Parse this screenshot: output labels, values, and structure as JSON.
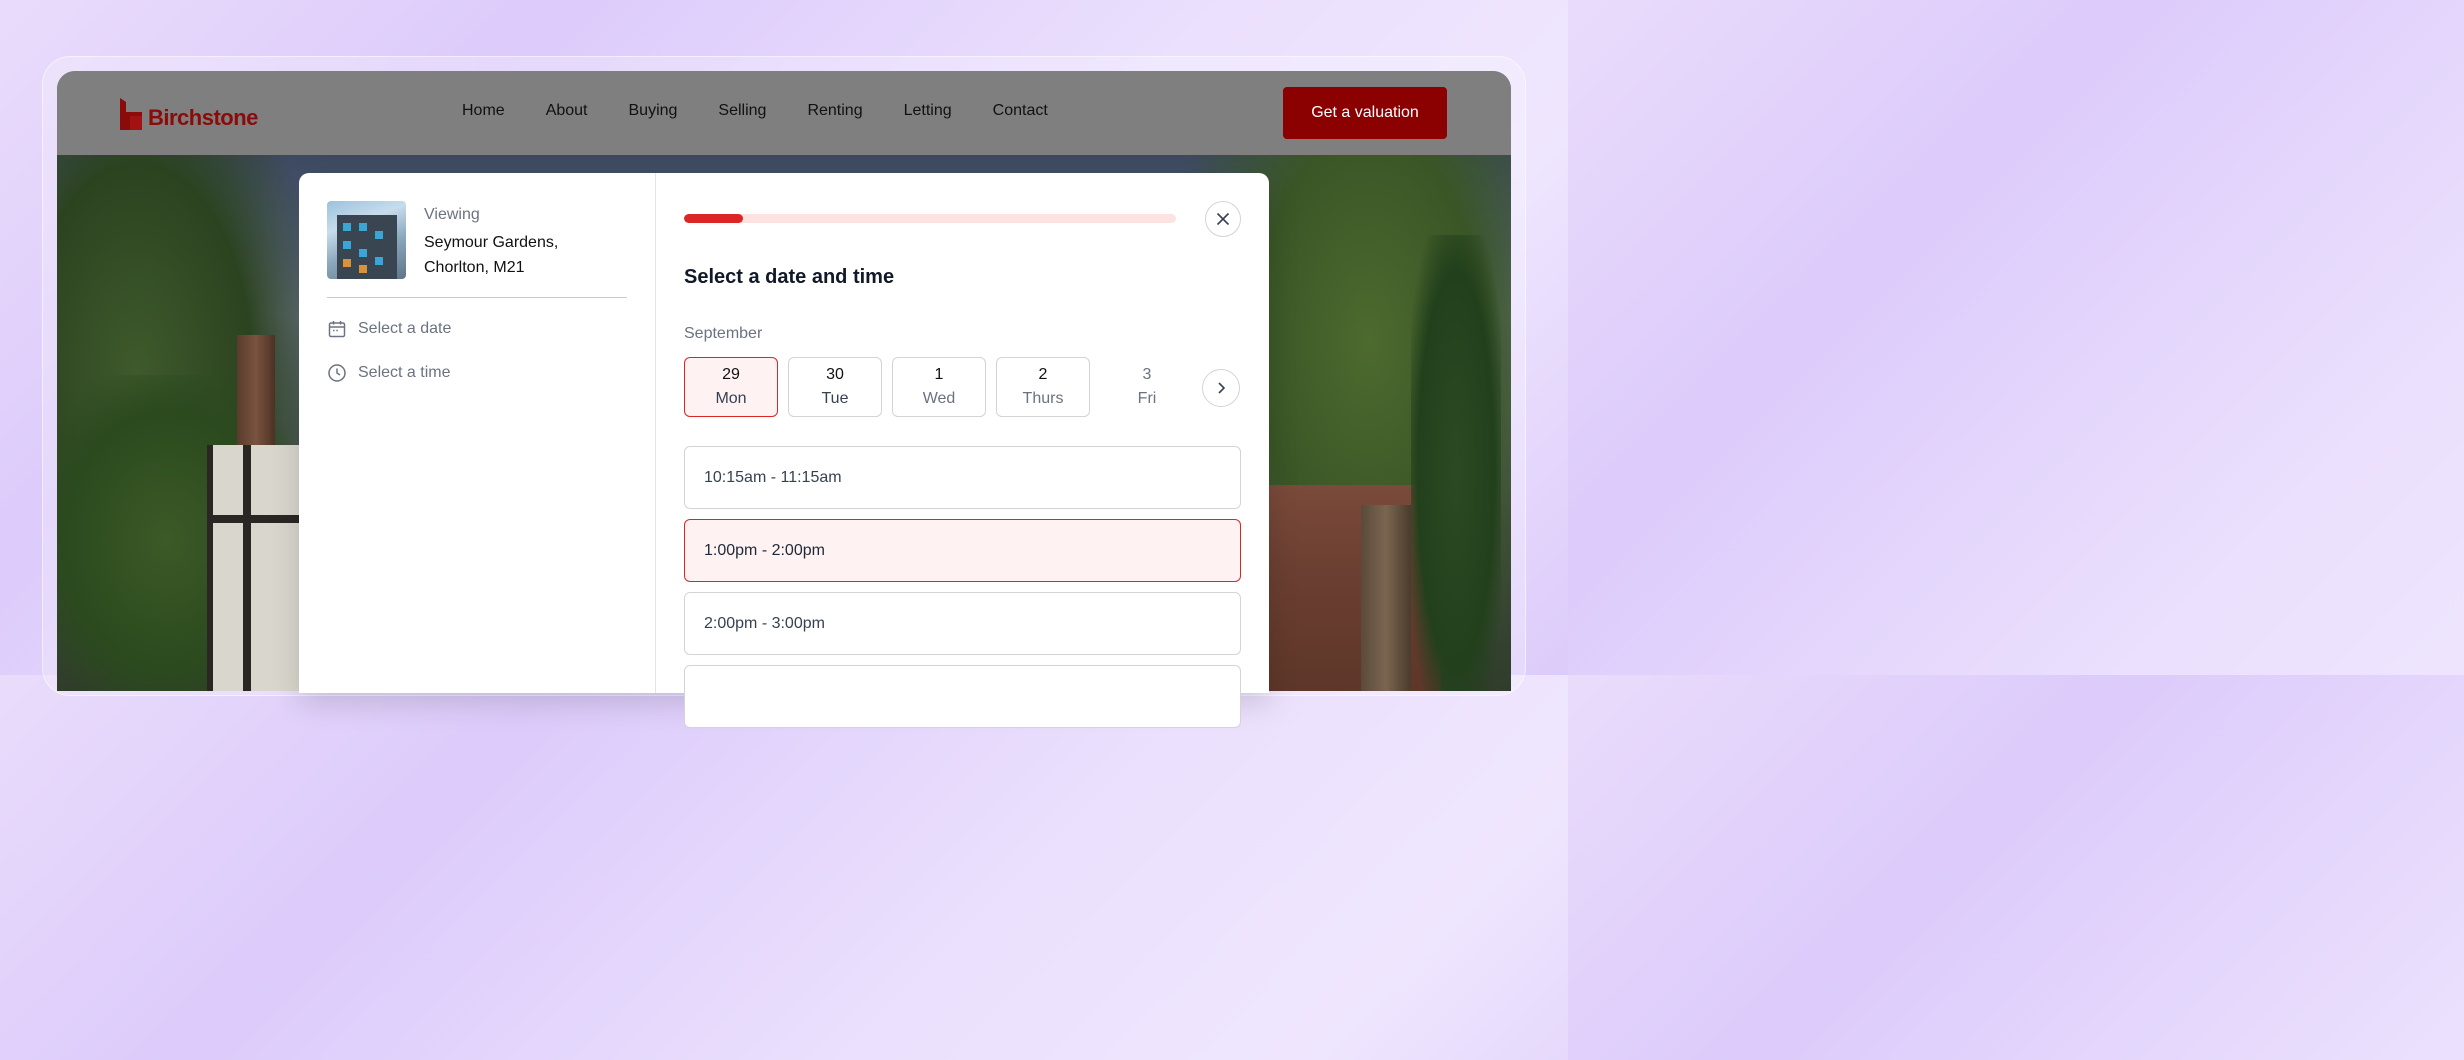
{
  "brand": {
    "name": "Birchstone",
    "color": "#8b0a0a"
  },
  "nav": {
    "links": [
      "Home",
      "About",
      "Buying",
      "Selling",
      "Renting",
      "Letting",
      "Contact"
    ],
    "cta": "Get a valuation"
  },
  "booking": {
    "summary": {
      "viewing_label": "Viewing",
      "address_line1": "Seymour Gardens,",
      "address_line2": "Chorlton, M21"
    },
    "steps": [
      {
        "label": "Select a date",
        "icon": "calendar-icon"
      },
      {
        "label": "Select a time",
        "icon": "clock-icon"
      }
    ],
    "progress": 0.12,
    "title": "Select a date and time",
    "month": "September",
    "dates": [
      {
        "num": "29",
        "day": "Mon",
        "state": "selected"
      },
      {
        "num": "30",
        "day": "Tue",
        "state": "available"
      },
      {
        "num": "1",
        "day": "Wed",
        "state": "available"
      },
      {
        "num": "2",
        "day": "Thurs",
        "state": "available"
      },
      {
        "num": "3",
        "day": "Fri",
        "state": "unavailable"
      }
    ],
    "slots": [
      {
        "label": "10:15am - 11:15am",
        "state": "available"
      },
      {
        "label": "1:00pm - 2:00pm",
        "state": "selected"
      },
      {
        "label": "2:00pm - 3:00pm",
        "state": "available"
      }
    ]
  },
  "colors": {
    "accent": "#dc2626",
    "accent_bg": "#fef2f2",
    "cta": "#8b0000"
  }
}
